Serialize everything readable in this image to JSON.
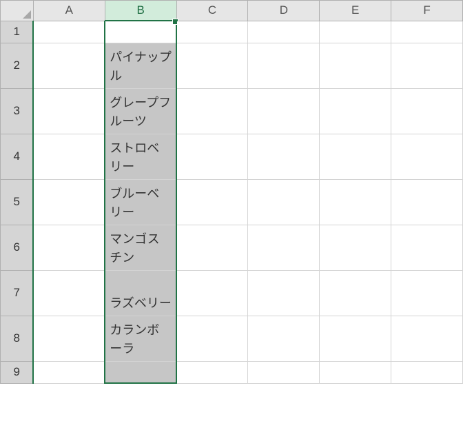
{
  "columns": [
    "A",
    "B",
    "C",
    "D",
    "E",
    "F"
  ],
  "rows": [
    "1",
    "2",
    "3",
    "4",
    "5",
    "6",
    "7",
    "8",
    "9"
  ],
  "selected_column": "B",
  "selection_range_rows": [
    1,
    9
  ],
  "active_cell": {
    "row": 1,
    "col": "B"
  },
  "cells": {
    "B2": "パイナップル",
    "B3": "グレープフルーツ",
    "B4": "ストロベリー",
    "B5": "ブルーベリー",
    "B6": "マンゴスチン",
    "B7": "ラズベリー",
    "B8": "カランボーラ"
  },
  "chart_data": {
    "type": "table",
    "title": "",
    "columns": [
      "B"
    ],
    "rows": [
      {
        "B": ""
      },
      {
        "B": "パイナップル"
      },
      {
        "B": "グレープフルーツ"
      },
      {
        "B": "ストロベリー"
      },
      {
        "B": "ブルーベリー"
      },
      {
        "B": "マンゴスチン"
      },
      {
        "B": "ラズベリー"
      },
      {
        "B": "カランボーラ"
      },
      {
        "B": ""
      }
    ]
  }
}
